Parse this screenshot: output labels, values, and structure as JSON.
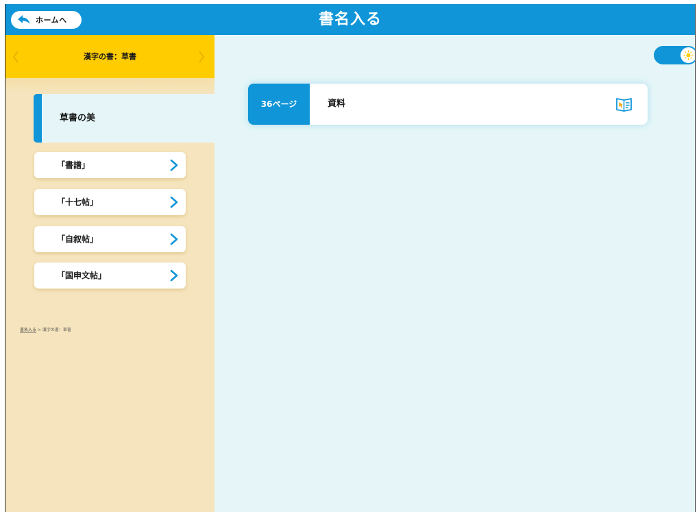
{
  "header": {
    "home_label": "ホームへ",
    "title": "書名入る"
  },
  "sidebar": {
    "chapter_title": "漢字の書：草書",
    "active_section": "草書の美",
    "items": [
      {
        "label": "「書譜」"
      },
      {
        "label": "「十七帖」"
      },
      {
        "label": "「自叙帖」"
      },
      {
        "label": "「国申文帖」"
      }
    ],
    "breadcrumb": {
      "link": "書名入る",
      "separator": " > ",
      "current": "漢字の書：草書"
    }
  },
  "main": {
    "toggle_state": "on",
    "documents": [
      {
        "page": "36ページ",
        "title": "資料",
        "icon": "book-icon"
      }
    ]
  },
  "colors": {
    "header": "#1095d8",
    "chapter_bar": "#ffcc00",
    "sidebar_bg": "#f5e4bd",
    "main_bg": "#e6f6f8",
    "accent": "#1095d8"
  }
}
